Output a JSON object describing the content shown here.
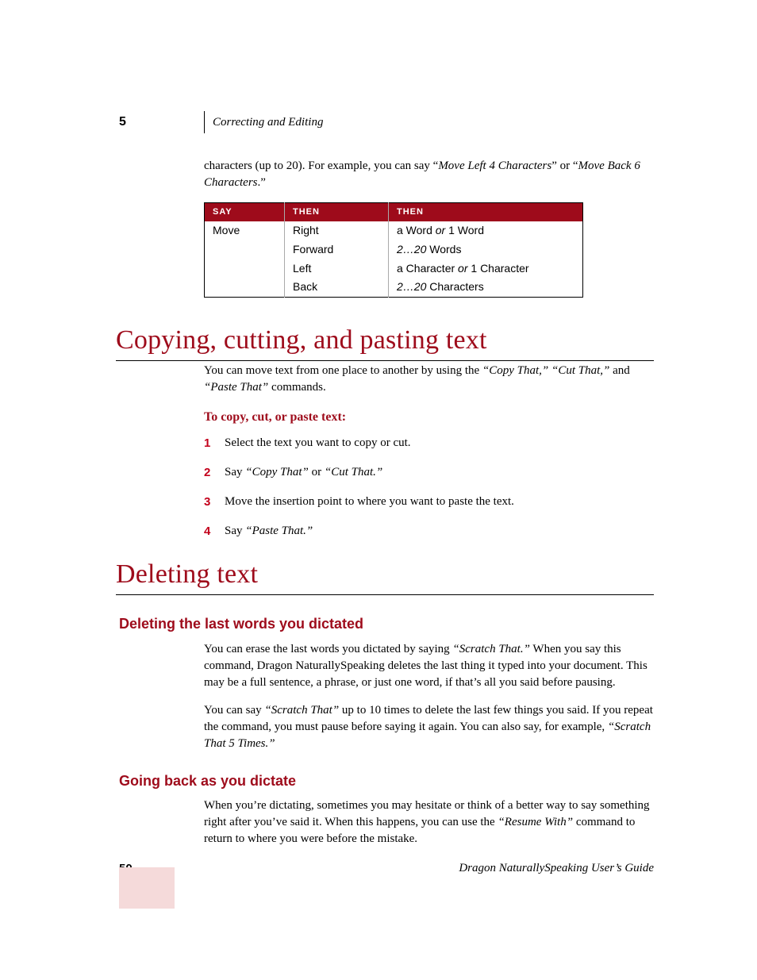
{
  "header": {
    "chapter_number": "5",
    "chapter_title": "Correcting and Editing"
  },
  "intro_para": {
    "pre": "characters (up to 20). For example, you can say “",
    "cmd1": "Move Left 4 Characters",
    "mid": "” or “",
    "cmd2": "Move Back 6 Characters",
    "post": ".”"
  },
  "table": {
    "headers": [
      "SAY",
      "THEN",
      "THEN"
    ],
    "rows": [
      {
        "c1": "Move",
        "c2": "Right",
        "c3a": "a Word ",
        "c3i": "or",
        "c3b": " 1 Word"
      },
      {
        "c1": "",
        "c2": "Forward",
        "c3a": "",
        "c3i": "2…20",
        "c3b": " Words"
      },
      {
        "c1": "",
        "c2": "Left",
        "c3a": "a Character ",
        "c3i": "or",
        "c3b": " 1 Character"
      },
      {
        "c1": "",
        "c2": "Back",
        "c3a": "",
        "c3i": "2…20",
        "c3b": " Characters"
      }
    ]
  },
  "section_copying": {
    "title": "Copying, cutting, and pasting text",
    "para_pre": "You can move text from one place to another by using the ",
    "para_cmds": "“Copy That,” “Cut That,”",
    "para_mid": " and ",
    "para_cmd3": "“Paste That”",
    "para_post": " commands.",
    "proc_title": "To copy, cut, or paste text:",
    "steps": [
      {
        "n": "1",
        "pre": "Select the text you want to copy or cut.",
        "it1": "",
        "mid": "",
        "it2": ""
      },
      {
        "n": "2",
        "pre": "Say ",
        "it1": "“Copy That”",
        "mid": " or ",
        "it2": "“Cut That.”"
      },
      {
        "n": "3",
        "pre": "Move the insertion point to where you want to paste the text.",
        "it1": "",
        "mid": "",
        "it2": ""
      },
      {
        "n": "4",
        "pre": "Say ",
        "it1": "“Paste That.”",
        "mid": "",
        "it2": ""
      }
    ]
  },
  "section_deleting": {
    "title": "Deleting text",
    "sub1_title": "Deleting the last words you dictated",
    "sub1_para1_pre": "You can erase the last words you dictated by saying ",
    "sub1_para1_cmd": "“Scratch That.”",
    "sub1_para1_post": " When you say this command, Dragon NaturallySpeaking deletes the last thing it typed into your document. This may be a full sentence, a phrase, or just one word, if that’s all you said before pausing.",
    "sub1_para2_pre": "You can say ",
    "sub1_para2_cmd1": "“Scratch That”",
    "sub1_para2_mid": " up to 10 times to delete the last few things you said. If you repeat the command, you must pause before saying it again. You can also say, for example, ",
    "sub1_para2_cmd2": "“Scratch That 5 Times.”",
    "sub2_title": "Going back as you dictate",
    "sub2_para_pre": "When you’re dictating, sometimes you may hesitate or think of a better way to say something right after you’ve said it. When this happens, you can use the ",
    "sub2_para_cmd": "“Resume With”",
    "sub2_para_post": " command to return to where you were before the mistake."
  },
  "footer": {
    "page": "50",
    "doc_title": "Dragon NaturallySpeaking User’s Guide"
  }
}
